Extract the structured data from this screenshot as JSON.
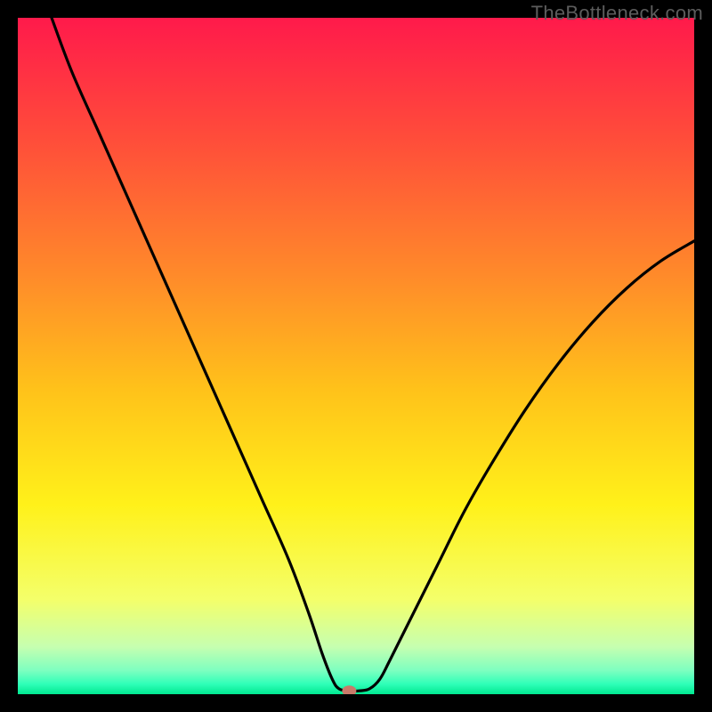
{
  "watermark": "TheBottleneck.com",
  "chart_data": {
    "type": "line",
    "title": "",
    "xlabel": "",
    "ylabel": "",
    "xlim": [
      0,
      100
    ],
    "ylim": [
      0,
      100
    ],
    "grid": false,
    "legend": false,
    "background_gradient_stops": [
      {
        "offset": 0.0,
        "color": "#ff1a4b"
      },
      {
        "offset": 0.18,
        "color": "#ff4d3a"
      },
      {
        "offset": 0.38,
        "color": "#ff8a2a"
      },
      {
        "offset": 0.55,
        "color": "#ffc21a"
      },
      {
        "offset": 0.72,
        "color": "#fff11a"
      },
      {
        "offset": 0.86,
        "color": "#f4ff6a"
      },
      {
        "offset": 0.93,
        "color": "#c6ffb0"
      },
      {
        "offset": 0.965,
        "color": "#7dffc0"
      },
      {
        "offset": 0.985,
        "color": "#2fffb8"
      },
      {
        "offset": 1.0,
        "color": "#00e890"
      }
    ],
    "curve": {
      "points": [
        {
          "x": 5,
          "y": 100
        },
        {
          "x": 8,
          "y": 92
        },
        {
          "x": 12,
          "y": 83
        },
        {
          "x": 16,
          "y": 74
        },
        {
          "x": 20,
          "y": 65
        },
        {
          "x": 24,
          "y": 56
        },
        {
          "x": 28,
          "y": 47
        },
        {
          "x": 32,
          "y": 38
        },
        {
          "x": 36,
          "y": 29
        },
        {
          "x": 40,
          "y": 20
        },
        {
          "x": 43,
          "y": 12
        },
        {
          "x": 45,
          "y": 6
        },
        {
          "x": 46.5,
          "y": 2.2
        },
        {
          "x": 47.5,
          "y": 0.8
        },
        {
          "x": 49,
          "y": 0.5
        },
        {
          "x": 50.5,
          "y": 0.5
        },
        {
          "x": 52,
          "y": 0.8
        },
        {
          "x": 53.5,
          "y": 2.2
        },
        {
          "x": 55,
          "y": 5
        },
        {
          "x": 58,
          "y": 11
        },
        {
          "x": 62,
          "y": 19
        },
        {
          "x": 66,
          "y": 27
        },
        {
          "x": 70,
          "y": 34
        },
        {
          "x": 75,
          "y": 42
        },
        {
          "x": 80,
          "y": 49
        },
        {
          "x": 85,
          "y": 55
        },
        {
          "x": 90,
          "y": 60
        },
        {
          "x": 95,
          "y": 64
        },
        {
          "x": 100,
          "y": 67
        }
      ]
    },
    "marker": {
      "x": 49,
      "y": 0.5,
      "rx": 8,
      "ry": 6,
      "fill": "#c97a6a"
    }
  }
}
